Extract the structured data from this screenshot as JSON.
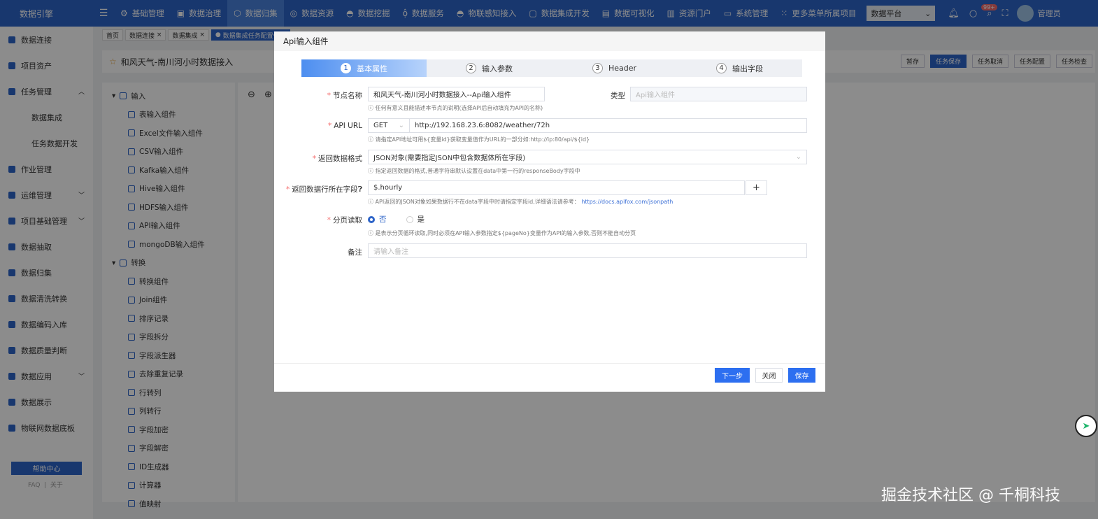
{
  "topbar": {
    "brand": "数据引擎",
    "nav": [
      "基础管理",
      "数据治理",
      "数据归集",
      "数据资源",
      "数据挖掘",
      "数据服务",
      "物联感知接入",
      "数据集成开发",
      "数据可视化",
      "资源门户",
      "系统管理",
      "更多菜单所属项目"
    ],
    "platform": "数据平台",
    "badge": "99+",
    "user": "管理员"
  },
  "sidebar": {
    "items": [
      "数据连接",
      "项目资产",
      "任务管理",
      "数据集成",
      "任务数据开发",
      "作业管理",
      "运维管理",
      "项目基础管理",
      "数据抽取",
      "数据归集",
      "数据清洗转换",
      "数据编码入库",
      "数据质量判断",
      "数据应用",
      "数据展示",
      "物联网数据底板"
    ],
    "help": "帮助中心",
    "faq": "FAQ",
    "about": "关于"
  },
  "tabs": [
    "首页",
    "数据连接",
    "数据集成",
    "数据集成任务配置任务"
  ],
  "page": {
    "title": "和风天气-南川河小时数据接入",
    "buttons": [
      "暂存",
      "任务保存",
      "任务取消",
      "任务配置",
      "任务检查"
    ]
  },
  "tree": {
    "input_group": "输入",
    "inputs": [
      "表输入组件",
      "Excel文件输入组件",
      "CSV输入组件",
      "Kafka输入组件",
      "Hive输入组件",
      "HDFS输入组件",
      "API输入组件",
      "mongoDB输入组件"
    ],
    "transform_group": "转换",
    "transforms": [
      "转换组件",
      "Join组件",
      "排序记录",
      "字段拆分",
      "字段派生器",
      "去除重复记录",
      "行转列",
      "列转行",
      "字段加密",
      "字段解密",
      "ID生成器",
      "计算器",
      "值映射"
    ]
  },
  "modal": {
    "title": "Api输入组件",
    "steps": [
      {
        "n": "1",
        "label": "基本属性"
      },
      {
        "n": "2",
        "label": "输入参数"
      },
      {
        "n": "3",
        "label": "Header"
      },
      {
        "n": "4",
        "label": "输出字段"
      }
    ],
    "node_name_label": "节点名称",
    "node_name": "和风天气-南川河小时数据接入--Api输入组件",
    "node_name_hint": "任何有意义且能描述本节点的说明(选择API后自动填充为API的名称)",
    "type_label": "类型",
    "type_value": "Api输入组件",
    "url_label": "API URL",
    "method": "GET",
    "url": "http://192.168.23.6:8082/weather/72h",
    "url_hint": "请指定API地址可用${变量id}获取变量值作为URL的一部分如:http://ip:80/api/${id}",
    "format_label": "返回数据格式",
    "format": "JSON对象(需要指定JSON中包含数据体所在字段)",
    "format_hint": "指定返回数据的格式,普通字符串默认设置在data中第一行的responseBody字段中",
    "field_label": "返回数据行所在字段",
    "field": "$.hourly",
    "field_hint": "API返回的JSON对象如果数据行不在data字段中时请指定字段id,详细语法请参考：",
    "field_link": "https://docs.apifox.com/jsonpath",
    "page_label": "分页读取",
    "page_no": "否",
    "page_yes": "是",
    "page_hint": "是表示分页循环读取,同时必须在API输入参数指定${pageNo}变量作为API的输入参数,否则不能自动分页",
    "remark_label": "备注",
    "remark_placeholder": "请输入备注",
    "next": "下一步",
    "close": "关闭",
    "save": "保存"
  },
  "watermark": "掘金技术社区 @ 千桐科技"
}
